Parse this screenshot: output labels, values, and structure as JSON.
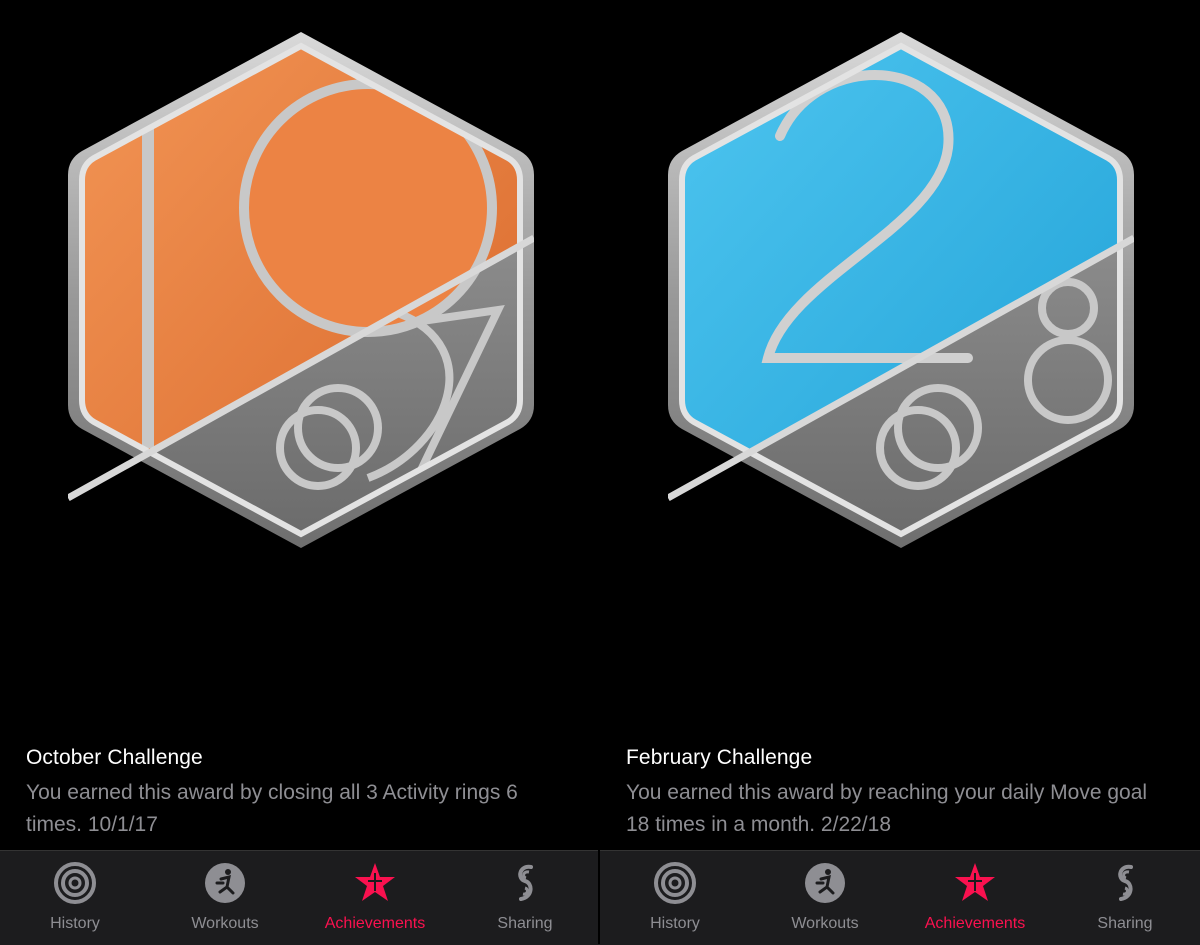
{
  "colors": {
    "background": "#000000",
    "tabbar": "#1c1c1e",
    "active_tab": "#fa114f",
    "inactive_tab": "#8e8e93",
    "october_badge": "#e8793a",
    "february_badge": "#36b8e8",
    "badge_metal": "#b8b8b8"
  },
  "panels": [
    {
      "badge": {
        "big_numeral": "10",
        "year": "2017",
        "icon": "october-challenge-badge"
      },
      "title": "October Challenge",
      "description": "You earned this award by closing all 3 Activity rings 6 times. 10/1/17",
      "tabs": [
        {
          "label": "History",
          "icon": "history-rings-icon",
          "active": false
        },
        {
          "label": "Workouts",
          "icon": "workouts-runner-icon",
          "active": false
        },
        {
          "label": "Achievements",
          "icon": "achievements-star-icon",
          "active": true
        },
        {
          "label": "Sharing",
          "icon": "sharing-icon",
          "active": false
        }
      ]
    },
    {
      "badge": {
        "big_numeral": "2",
        "year": "2018",
        "icon": "february-challenge-badge"
      },
      "title": "February Challenge",
      "description": "You earned this award by reaching your daily Move goal 18 times in a month. 2/22/18",
      "tabs": [
        {
          "label": "History",
          "icon": "history-rings-icon",
          "active": false
        },
        {
          "label": "Workouts",
          "icon": "workouts-runner-icon",
          "active": false
        },
        {
          "label": "Achievements",
          "icon": "achievements-star-icon",
          "active": true
        },
        {
          "label": "Sharing",
          "icon": "sharing-icon",
          "active": false
        }
      ]
    }
  ]
}
